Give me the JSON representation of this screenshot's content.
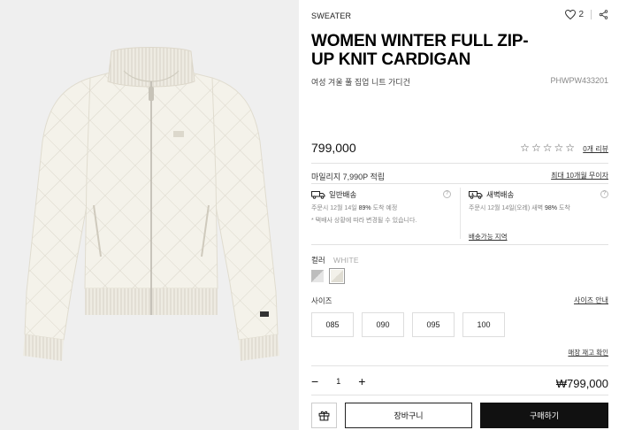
{
  "product": {
    "category": "SWEATER",
    "like_count": "2",
    "title": "WOMEN WINTER FULL ZIP-UP KNIT CARDIGAN",
    "subtitle": "여성 겨울 풀 집업 니트 가디건",
    "code": "PHWPW433201",
    "price": "799,000",
    "rating": 0,
    "reviews_label": "0개 리뷰",
    "image": {
      "description_icon": "cardigan-image",
      "background": "#efefef"
    }
  },
  "benefits": {
    "mileage": "마일리지 7,990P 적립",
    "installment": "최대 10개월 무이자"
  },
  "shipping": {
    "standard": {
      "title": "일반배송",
      "line1_prefix": "주문시 12월 14일",
      "line1_pct": "89%",
      "line1_suffix": "도착 예정",
      "line2": "* 택배사 상황에 따라 변경될 수 있습니다."
    },
    "dawn": {
      "title": "새벽배송",
      "line1_prefix": "주문시 12월 14일(오레) 새벽",
      "line1_pct": "98%",
      "line1_suffix": "도착"
    },
    "area_link": "배송가능 지역"
  },
  "options": {
    "color_label": "컬러",
    "color_value": "WHITE",
    "swatches": [
      "grey-swatch",
      "white-swatch"
    ],
    "size_label": "사이즈",
    "size_guide": "사이즈 안내",
    "sizes": [
      "085",
      "090",
      "095",
      "100"
    ],
    "stock_link": "매장 재고 확인"
  },
  "order": {
    "minus": "−",
    "quantity": "1",
    "plus": "+",
    "total": "₩799,000",
    "cart_label": "장바구니",
    "buy_label": "구매하기"
  },
  "colors": {
    "accent": "#111111",
    "border": "#dddddd",
    "muted": "#888888"
  }
}
